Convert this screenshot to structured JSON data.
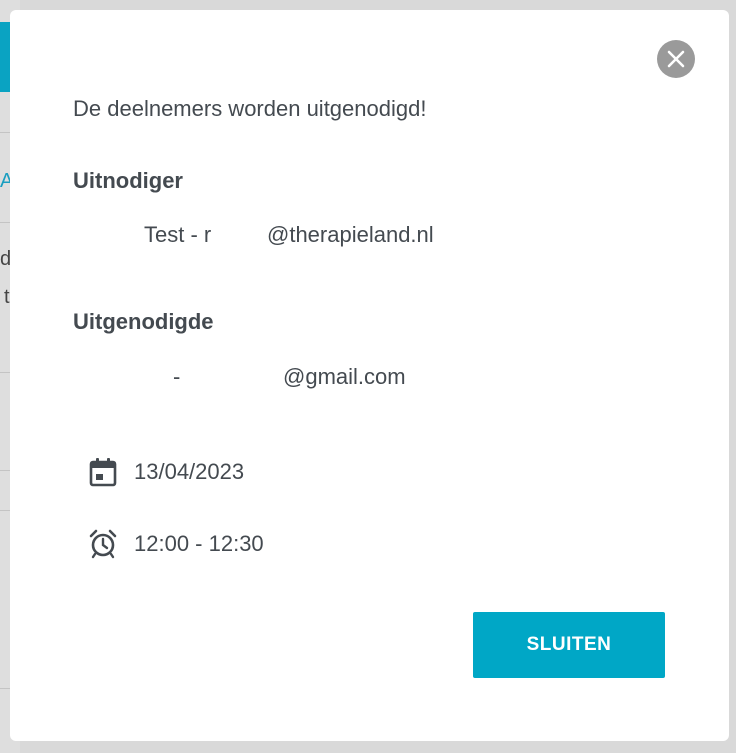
{
  "background": {
    "fragments": [
      "A",
      "d",
      "t"
    ]
  },
  "modal": {
    "message": "De deelnemers worden uitgenodigd!",
    "inviter": {
      "title": "Uitnodiger",
      "name": "Test - r",
      "email_domain": "@therapieland.nl"
    },
    "invitee": {
      "title": "Uitgenodigde",
      "separator": "-",
      "email_domain": "@gmail.com"
    },
    "date": {
      "icon": "calendar-icon",
      "value": "13/04/2023"
    },
    "time": {
      "icon": "alarm-clock-icon",
      "value": "12:00 - 12:30"
    },
    "close_button_icon": "close-icon",
    "confirm_label": "SLUITEN"
  },
  "colors": {
    "accent": "#00a7c6",
    "text": "#444a50",
    "close_button": "#9a9a9a"
  }
}
